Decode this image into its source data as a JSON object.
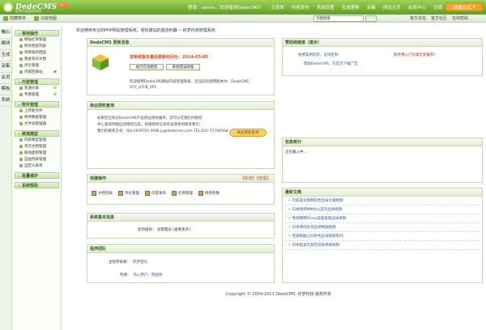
{
  "app": {
    "name": "DedeCMS",
    "version": "V5.7",
    "subtitle": "织梦内容管理系统"
  },
  "topnav": [
    "登录：admin，欢迎使用DedeCMS！",
    "主菜单",
    "内容发布",
    "系统设置",
    "生成更新",
    "采集",
    "网站主页",
    "会员中心",
    "注销"
  ],
  "quick_button": "快捷方式",
  "subbar": {
    "hide_menu": "隐藏菜单",
    "func_map": "功能地图",
    "search_value": "功能搜索",
    "right_links": [
      "官方论坛",
      "官方社区",
      "在线帮助"
    ]
  },
  "vtabs": [
    "核心",
    "模块",
    "生成",
    "采集",
    "会员",
    "模板",
    "系统"
  ],
  "menu": [
    {
      "title": "常用操作",
      "items": [
        "网站栏目管理",
        "所有档案列表",
        "等审核的档案",
        "我发布的文档",
        "评论管理",
        "内容回收站"
      ]
    },
    {
      "title": "内容管理",
      "items": [
        "普通文章",
        "专题管理"
      ]
    },
    {
      "title": "附件管理",
      "items": [
        "上传新文件",
        "附件数据管理",
        "文件式管理器"
      ]
    },
    {
      "title": "频道模型",
      "items": [
        "内容模型管理",
        "单页文档管理",
        "联动类别管理",
        "自由列表管理",
        "自定义表单"
      ]
    },
    {
      "title": "批量维护",
      "items": []
    },
    {
      "title": "系统帮助",
      "items": []
    }
  ],
  "welcome": "欢迎使用专业的PHP网站管理系统，轻松建站的首选利器 -- 织梦内容管理系统",
  "update_panel": {
    "title": "DedeCMS 更新消息",
    "latest": "您系统版本最后更新时间为：2014-03-05",
    "btn_update": "进行在线更新",
    "btn_check": "系统错误修复",
    "intro": "欢迎使用DedeCMS网站内容管理系统，您当前的使用版本为：DedeCMS V57_UTF8_SP1"
  },
  "license_panel": {
    "title": "商业授权查询",
    "lines": [
      "如果您已购买DedeCMS产品商业授权服务，您可以在我们的授权",
      "中心查询到相应的授权信息，如果授权信息有误请及时联系我们。",
      "我们的联系方式：QQ:1639781 MSN:jy@dedecms.com TEL:021-57700568"
    ],
    "query_btn": "商业授权查询"
  },
  "quick_panel": {
    "title": "快捷操作",
    "actions": "【新增】【管理】",
    "items": [
      "文档列表",
      "评论管理",
      "内容发布",
      "栏目管理",
      "修改参数"
    ]
  },
  "sys_panel": {
    "title": "系统基本信息",
    "text": "您的级别：  总管理员 [查看更多]"
  },
  "team_panel": {
    "title": "程序团队",
    "dev_label": "主程序研发：",
    "dev_value": "织梦团队",
    "thanks_label": "鸣谢：",
    "thanks_value": "热心用户、赞助商"
  },
  "ads_panel": {
    "title": "赞助商链接（提示）",
    "l1": "免费案例欣赏，支持定制",
    "l2": "新手用入门文章全新推荐！",
    "l3": "赞助DedeCMS，在官方下载广告"
  },
  "stat_panel": {
    "title": "信息统计",
    "text": "正在载入中..."
  },
  "docs_panel": {
    "title": "最新文档",
    "items": [
      "内容美女视频的色丝袜大腿视频",
      "日本性感MM办公室内丝袜视频",
      "性感模特Olivia美丽美图丝袜视频",
      "日本清纯女优丝袜制服视频",
      "性爱制服之间的色丝袜视频系列",
      "日本超美玩具玩丝袜诱惑视频"
    ]
  },
  "footer": "Copyright © 2004-2011 DedeCMS. 织梦科技 版权所有"
}
